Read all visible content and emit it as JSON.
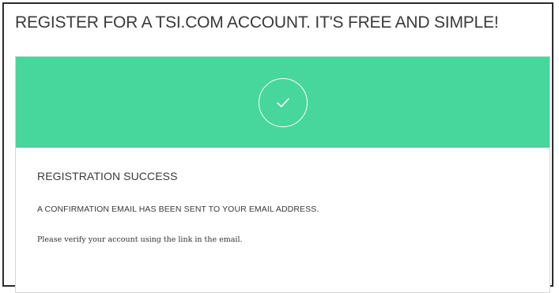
{
  "page": {
    "title": "REGISTER FOR A TSI.COM ACCOUNT. IT'S FREE AND SIMPLE!"
  },
  "banner": {
    "color": "#47d69b",
    "icon": "check-icon"
  },
  "message": {
    "heading": "REGISTRATION SUCCESS",
    "confirmation": "A CONFIRMATION EMAIL HAS BEEN SENT TO YOUR EMAIL ADDRESS.",
    "instruction": "Please verify your account using the link in the email."
  }
}
